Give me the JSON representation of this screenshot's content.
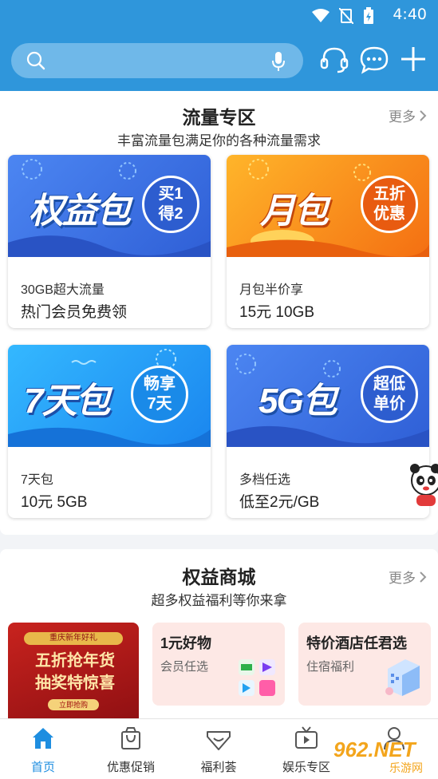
{
  "status_bar": {
    "time": "4:40"
  },
  "search": {
    "placeholder": ""
  },
  "section_traffic": {
    "title": "流量专区",
    "subtitle": "丰富流量包满足你的各种流量需求",
    "more": "更多",
    "packages": [
      {
        "banner_title": "权益包",
        "badge": [
          "买1",
          "得2"
        ],
        "line1": "30GB超大流量",
        "line2": "热门会员免费领",
        "color": "#3a6fe0"
      },
      {
        "banner_title": "月包",
        "badge": [
          "五折",
          "优惠"
        ],
        "line1": "月包半价享",
        "line2": "15元 10GB",
        "color": "#f58a1f"
      },
      {
        "banner_title": "7天包",
        "badge": [
          "畅享",
          "7天"
        ],
        "line1": "7天包",
        "line2": "10元 5GB",
        "color": "#1ea0f0"
      },
      {
        "banner_title": "5G包",
        "badge": [
          "超低",
          "单价"
        ],
        "line1": "多档任选",
        "line2": "低至2元/GB",
        "color": "#3a6fe0"
      }
    ]
  },
  "section_mall": {
    "title": "权益商城",
    "subtitle": "超多权益福利等你来拿",
    "more": "更多",
    "promo": {
      "top": "重庆新年好礼",
      "main": [
        "五折抢年货",
        "抽奖特惊喜"
      ],
      "button": "立即抢购"
    },
    "cards": [
      {
        "title": "1元好物",
        "sub": "会员任选"
      },
      {
        "title": "特价酒店任君选",
        "sub": "住宿福利"
      }
    ]
  },
  "tabbar": {
    "items": [
      {
        "label": "首页",
        "icon": "home-icon",
        "active": true
      },
      {
        "label": "优惠促销",
        "icon": "shopping-bag-icon",
        "active": false
      },
      {
        "label": "福利荟",
        "icon": "gift-heart-icon",
        "active": false
      },
      {
        "label": "娱乐专区",
        "icon": "tv-icon",
        "active": false
      },
      {
        "label": "",
        "icon": "person-icon",
        "active": false
      }
    ]
  },
  "watermark": {
    "brand": "962.NET",
    "sub": "乐游网"
  },
  "colors": {
    "primary": "#2f96db",
    "active_tab": "#1e8ee0"
  }
}
